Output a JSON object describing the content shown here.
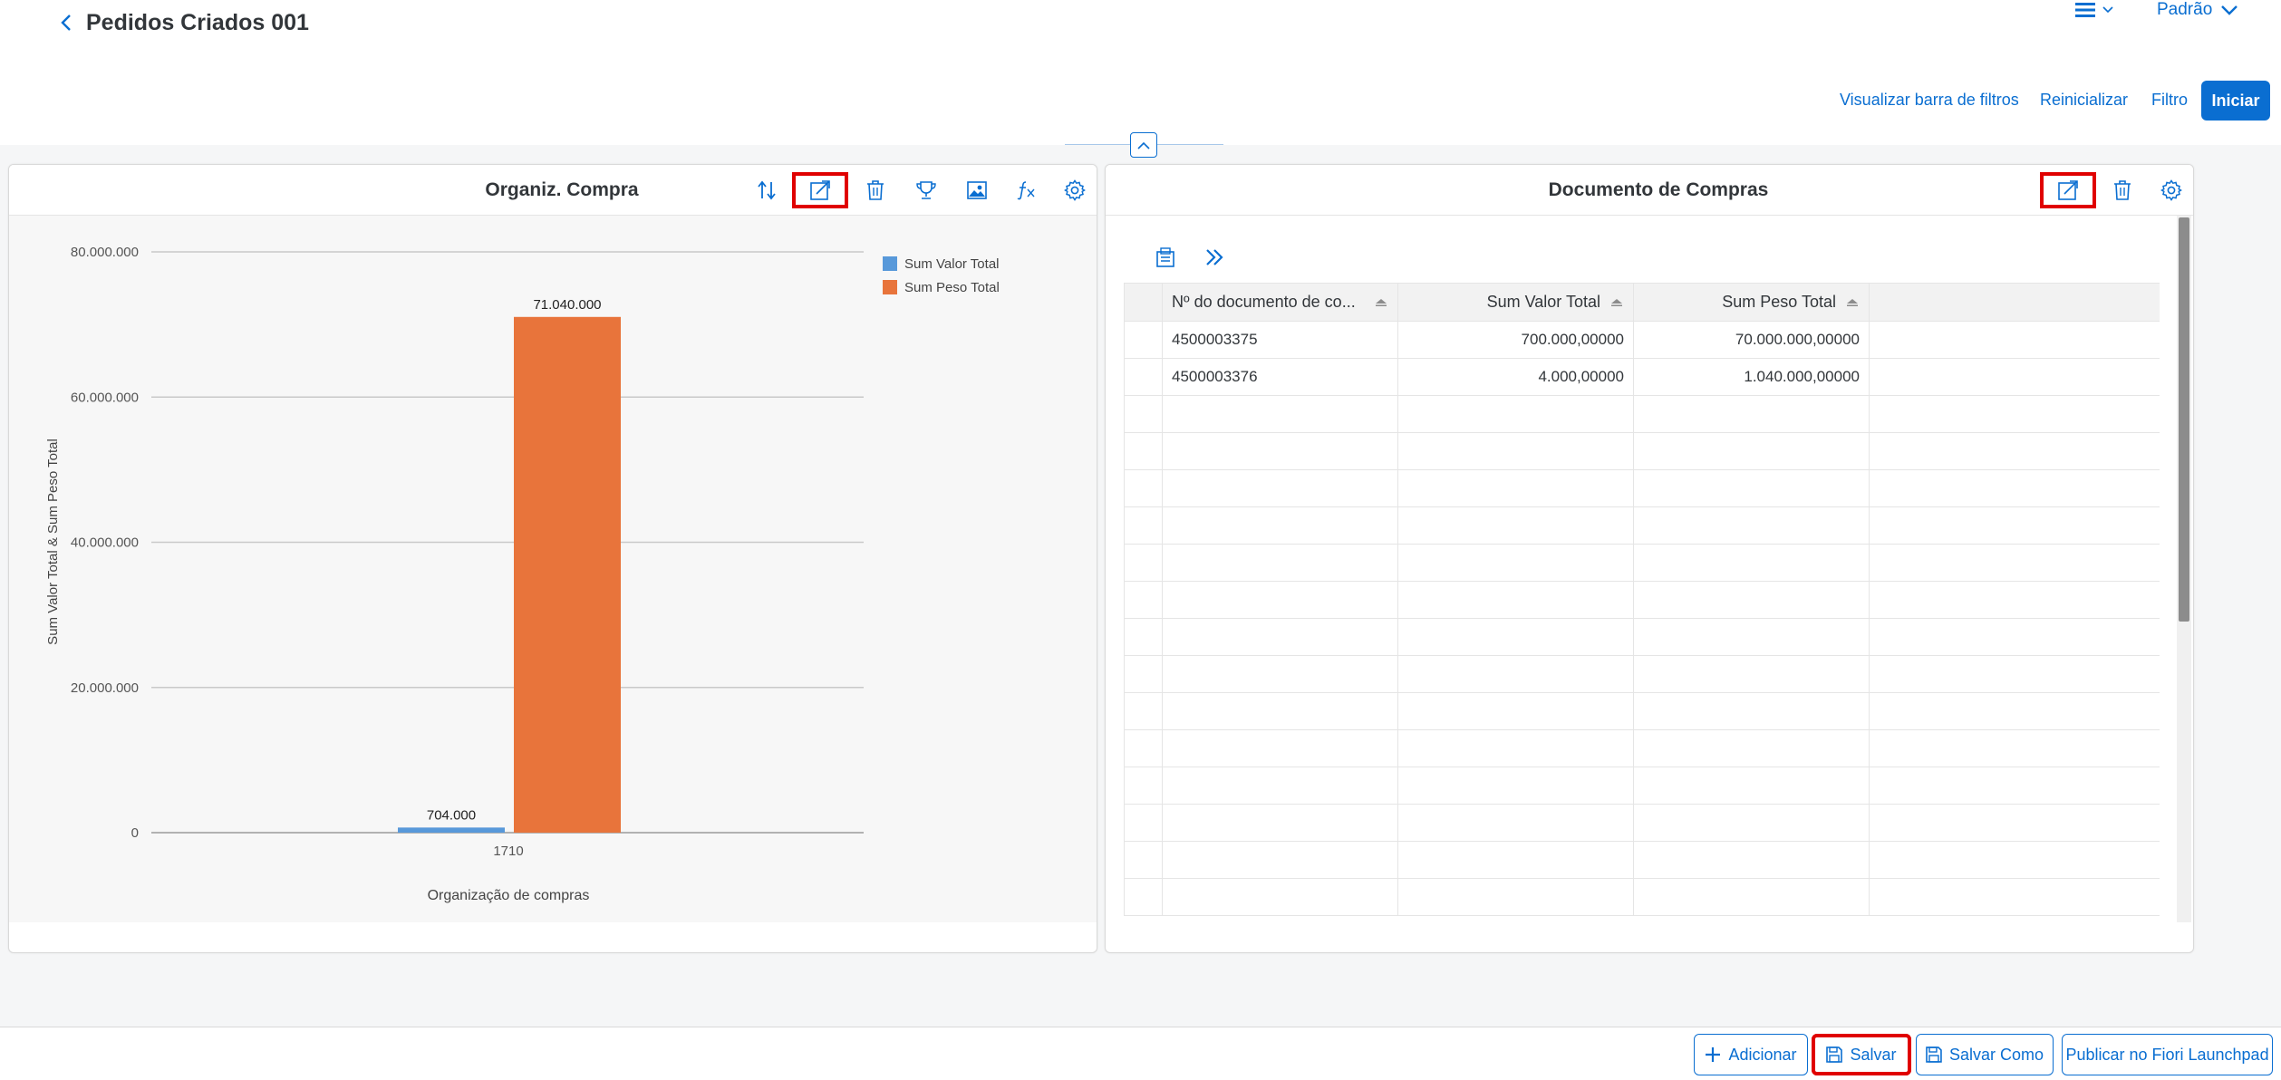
{
  "header": {
    "title": "Pedidos Criados 001",
    "variant": "Padrão"
  },
  "filterbar": {
    "show_filter_bar": "Visualizar barra de filtros",
    "reset": "Reinicializar",
    "filter": "Filtro",
    "go": "Iniciar"
  },
  "chart_panel": {
    "title": "Organiz. Compra",
    "chart_data": {
      "type": "bar",
      "categories": [
        "1710"
      ],
      "series": [
        {
          "name": "Sum Valor Total",
          "values": [
            704000
          ],
          "color": "#5899da",
          "label": "704.000"
        },
        {
          "name": "Sum Peso Total",
          "values": [
            71040000
          ],
          "color": "#e8743b",
          "label": "71.040.000"
        }
      ],
      "xlabel": "Organização de compras",
      "ylabel": "Sum Valor Total & Sum Peso Total",
      "ylim": [
        0,
        80000000
      ],
      "yticks": [
        {
          "value": 0,
          "label": "0"
        },
        {
          "value": 20000000,
          "label": "20.000.000"
        },
        {
          "value": 40000000,
          "label": "40.000.000"
        },
        {
          "value": 60000000,
          "label": "60.000.000"
        },
        {
          "value": 80000000,
          "label": "80.000.000"
        }
      ],
      "grid": true,
      "legend": "top-right"
    }
  },
  "table_panel": {
    "title": "Documento de Compras",
    "columns": [
      "Nº do documento de co...",
      "Sum Valor Total",
      "Sum Peso Total"
    ],
    "rows": [
      [
        "4500003375",
        "700.000,00000",
        "70.000.000,00000"
      ],
      [
        "4500003376",
        "4.000,00000",
        "1.040.000,00000"
      ]
    ]
  },
  "footer": {
    "add": "Adicionar",
    "save": "Salvar",
    "save_as": "Salvar Como",
    "publish": "Publicar no Fiori Launchpad"
  },
  "colors": {
    "accent": "#0a6ed1",
    "highlight": "#e00000"
  }
}
